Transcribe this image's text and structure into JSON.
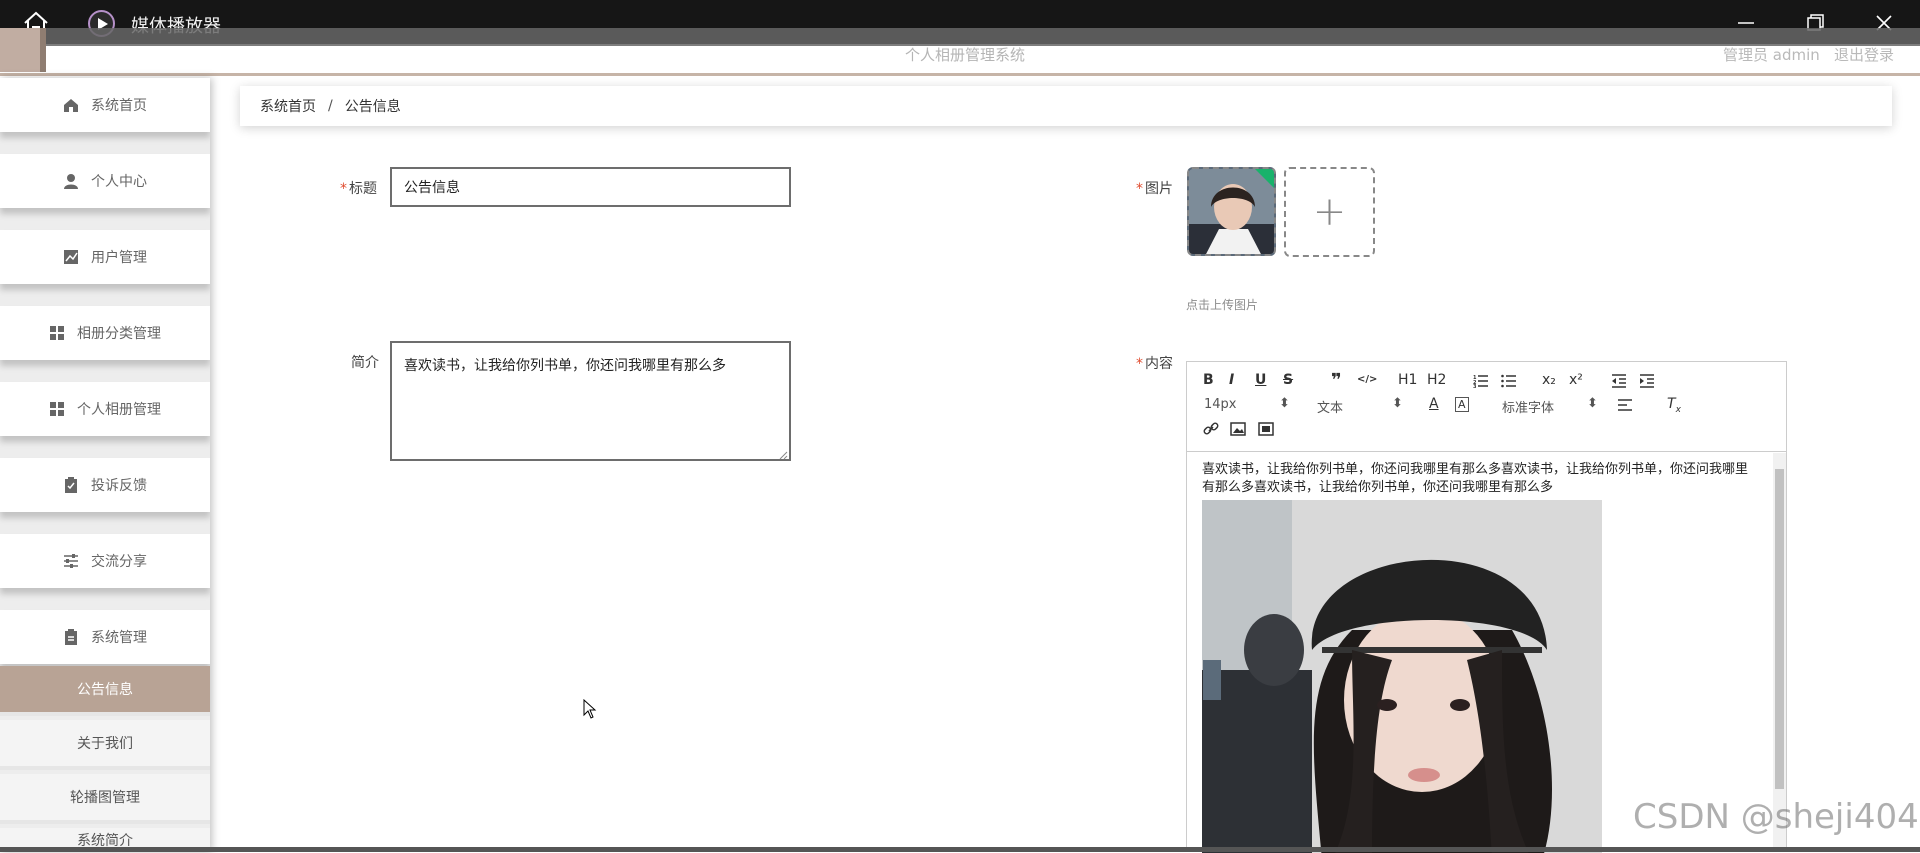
{
  "window": {
    "title": "媒体播放器",
    "icons": [
      "home-icon",
      "media-player-logo-icon",
      "minimize-icon",
      "maximize-icon",
      "close-icon"
    ]
  },
  "header": {
    "system_title": "个人相册管理系统",
    "user": "管理员 admin",
    "logout": "退出登录"
  },
  "sidebar": {
    "items": [
      {
        "label": "系统首页",
        "icon": "home-icon"
      },
      {
        "label": "个人中心",
        "icon": "user-icon"
      },
      {
        "label": "用户管理",
        "icon": "chart-icon"
      },
      {
        "label": "相册分类管理",
        "icon": "grid-icon"
      },
      {
        "label": "个人相册管理",
        "icon": "grid-icon"
      },
      {
        "label": "投诉反馈",
        "icon": "clipboard-check-icon"
      },
      {
        "label": "交流分享",
        "icon": "sliders-icon"
      },
      {
        "label": "系统管理",
        "icon": "clipboard-icon"
      }
    ],
    "sub_items": [
      {
        "label": "公告信息",
        "active": true
      },
      {
        "label": "关于我们",
        "active": false
      },
      {
        "label": "轮播图管理",
        "active": false
      },
      {
        "label": "系统简介",
        "active": false
      }
    ]
  },
  "breadcrumb": {
    "home": "系统首页",
    "separator": "/",
    "current": "公告信息"
  },
  "form": {
    "title_label": "标题",
    "title_value": "公告信息",
    "intro_label": "简介",
    "intro_value": "喜欢读书，让我给你列书单，你还问我哪里有那么多",
    "image_label": "图片",
    "upload_hint": "点击上传图片",
    "upload_plus": "+",
    "content_label": "内容",
    "required_mark": "*"
  },
  "editor": {
    "toolbar_row1": [
      "B",
      "I",
      "U",
      "S",
      "❞",
      "</>",
      "H1",
      "H2",
      "ol",
      "ul",
      "x₂",
      "x²",
      "outdent",
      "indent"
    ],
    "font_size": "14px",
    "block_type": "文本",
    "font_family": "标准字体",
    "content_text": "喜欢读书，让我给你列书单，你还问我哪里有那么多喜欢读书，让我给你列书单，你还问我哪里有那么多喜欢读书，让我给你列书单，你还问我哪里有那么多"
  },
  "watermark": "CSDN @sheji404",
  "colors": {
    "accent": "#b8a395",
    "required": "#e04b2e",
    "titlebar": "#161616"
  }
}
